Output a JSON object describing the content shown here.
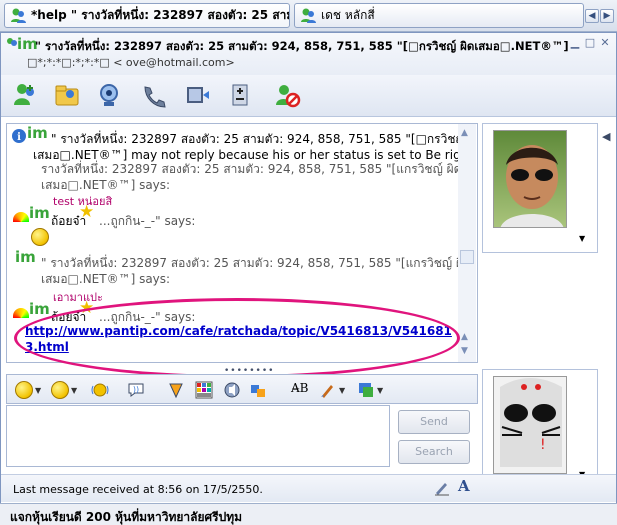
{
  "tabs": [
    {
      "label": "*help \" รางวัลที่หนึ่ง: 232897 สองตัว: 25  สามตั...",
      "active": true
    },
    {
      "label": "เดช หลักสี่",
      "active": false
    }
  ],
  "window": {
    "title": "\" รางวัลที่หนึ่ง: 232897 สองตัว: 25  สามตัว: 924, 858, 751, 585  \"[□กรวิชญ์ ผิดเสมอ□.NET®™]",
    "subtitle": "□*;*:*□:*;*:*□  <          ove@hotmail.com>"
  },
  "toolbar_icons": [
    "invite-contact-icon",
    "send-files-icon",
    "webcam-icon",
    "call-icon",
    "video-icon",
    "activities-icon",
    "block-icon"
  ],
  "messages": {
    "info_line1": "\" รางวัลที่หนึ่ง: 232897 สองตัว: 25  สามตัว: 924, 858, 751, 585  \"[□กรวิชญ์ ผิด",
    "info_line2": "เสมอ□.NET®™] may not reply because his or her status is set to Be right back.",
    "m1_header": "รางวัลที่หนึ่ง: 232897 สองตัว: 25  สามตัว: 924, 858, 751, 585  \"[แกรวิชญ์ ผิด",
    "m1_header2": "เสมอ□.NET®™] says:",
    "m1_text": "test หน่อยสิ",
    "m2_name": "ถ้อยจ๋า",
    "m2_says": "...ถูกกิน-_-\" says:",
    "m3_header": "\" รางวัลที่หนึ่ง: 232897 สองตัว: 25  สามตัว: 924, 858, 751, 585  \"[แกรวิชญ์ ผิด",
    "m3_header2": "เสมอ□.NET®™] says:",
    "m3_text": "เอามาแปะ",
    "m4_name": "ถ้อยจ๋า",
    "m4_says": "...ถูกกิน-_-\" says:",
    "link_line1": "http://www.pantip.com/cafe/ratchada/topic/V5416813/V541681",
    "link_line2": "3.html",
    "partial_bottom": "\" รางวัลที่หนึ่ง: 232897"
  },
  "compose": {
    "send_label": "Send",
    "search_label": "Search",
    "input_value": ""
  },
  "status": {
    "last_message": "Last message received at 8:56 on 17/5/2550."
  },
  "bottom_text": "แจกหุ้นเรียนดี 200 หุ้นที่มหาวิทยาลัยศรีปทุม",
  "colors": {
    "annotation": "#e0147d",
    "link": "#0000cc",
    "im_green": "#39a43a"
  }
}
